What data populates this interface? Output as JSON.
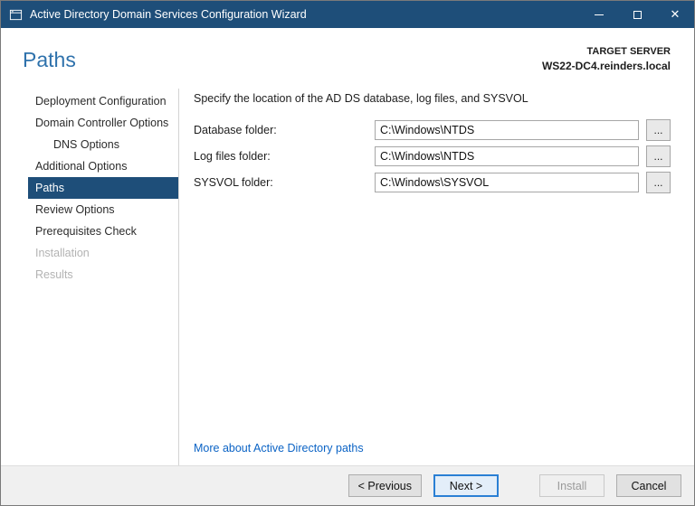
{
  "window": {
    "title": "Active Directory Domain Services Configuration Wizard",
    "icons": {
      "app": "wizard-window-icon",
      "minimize": "minimize-bar",
      "maximize": "square-outline",
      "close": "✕"
    }
  },
  "header": {
    "page_title": "Paths",
    "target_server_label": "TARGET SERVER",
    "target_server_value": "WS22-DC4.reinders.local"
  },
  "sidebar": {
    "items": [
      {
        "label": "Deployment Configuration",
        "state": "normal",
        "indent": 0
      },
      {
        "label": "Domain Controller Options",
        "state": "normal",
        "indent": 0
      },
      {
        "label": "DNS Options",
        "state": "normal",
        "indent": 1
      },
      {
        "label": "Additional Options",
        "state": "normal",
        "indent": 0
      },
      {
        "label": "Paths",
        "state": "selected",
        "indent": 0
      },
      {
        "label": "Review Options",
        "state": "normal",
        "indent": 0
      },
      {
        "label": "Prerequisites Check",
        "state": "normal",
        "indent": 0
      },
      {
        "label": "Installation",
        "state": "disabled",
        "indent": 0
      },
      {
        "label": "Results",
        "state": "disabled",
        "indent": 0
      }
    ]
  },
  "content": {
    "instruction": "Specify the location of the AD DS database, log files, and SYSVOL",
    "fields": [
      {
        "label": "Database folder:",
        "value": "C:\\Windows\\NTDS",
        "browse": "..."
      },
      {
        "label": "Log files folder:",
        "value": "C:\\Windows\\NTDS",
        "browse": "..."
      },
      {
        "label": "SYSVOL folder:",
        "value": "C:\\Windows\\SYSVOL",
        "browse": "..."
      }
    ],
    "link": "More about Active Directory paths"
  },
  "footer": {
    "buttons": [
      {
        "label": "< Previous",
        "state": "normal"
      },
      {
        "label": "Next >",
        "state": "focused"
      },
      {
        "label": "Install",
        "state": "disabled"
      },
      {
        "label": "Cancel",
        "state": "normal"
      }
    ]
  },
  "colors": {
    "titlebar": "#1e4e79",
    "selected_step": "#1e4e79",
    "heading": "#2f72ac",
    "link": "#0b63c5",
    "focus_border": "#2a7fd4"
  }
}
